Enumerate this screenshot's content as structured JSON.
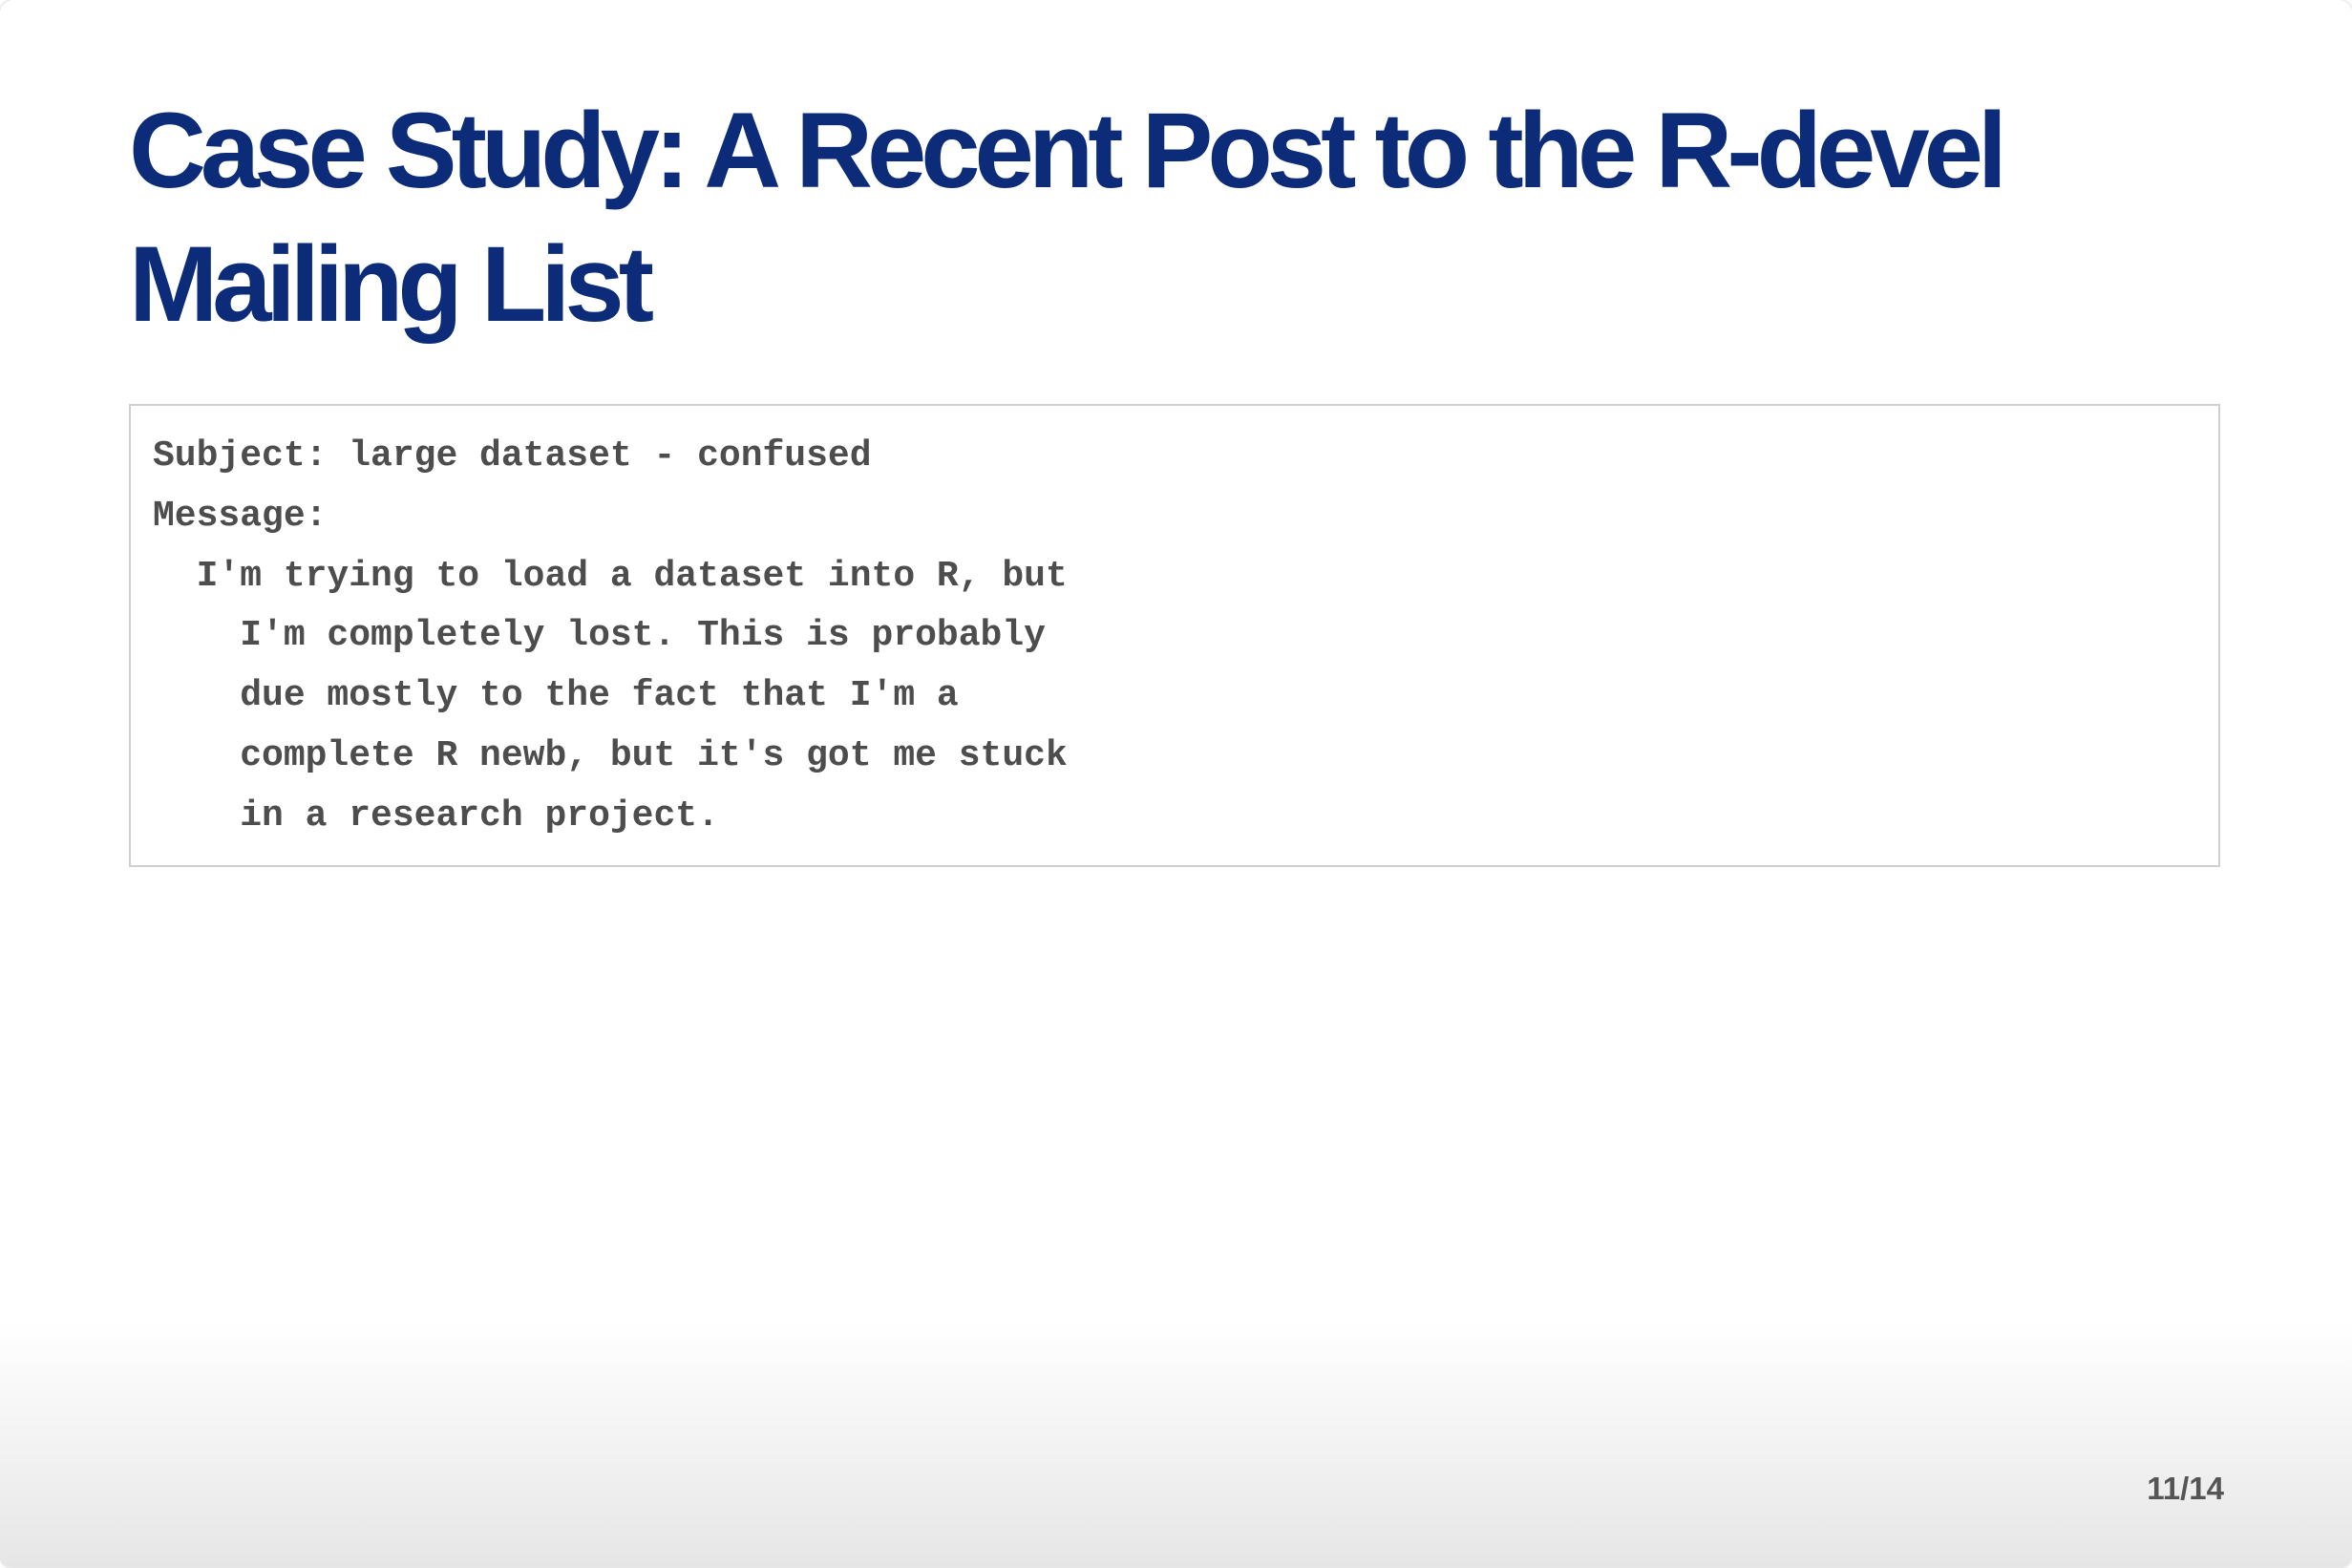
{
  "slide": {
    "title": "Case Study: A Recent Post to the R-devel Mailing List",
    "code_block": {
      "lines": [
        "Subject: large dataset - confused",
        "Message:",
        "  I'm trying to load a dataset into R, but",
        "    I'm completely lost. This is probably",
        "    due mostly to the fact that I'm a",
        "    complete R newb, but it's got me stuck",
        "    in a research project."
      ]
    },
    "page_number": "11/14"
  }
}
